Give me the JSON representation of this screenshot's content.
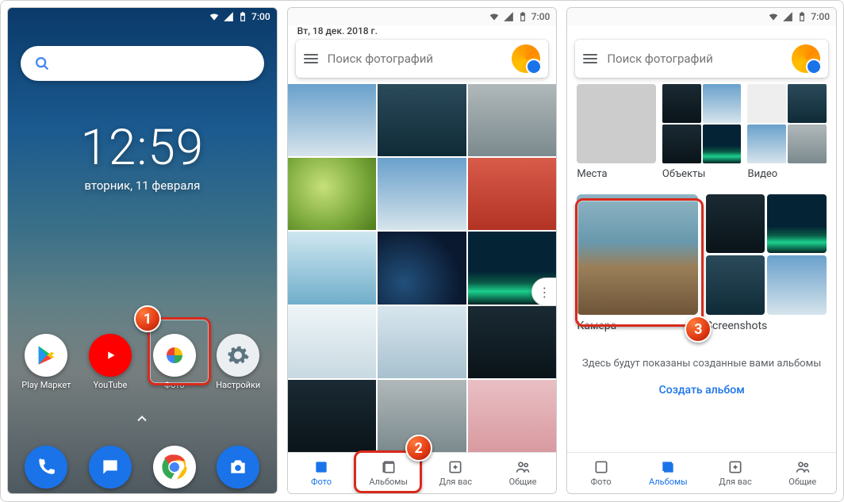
{
  "status_time": "7:00",
  "home": {
    "clock_time": "12:59",
    "clock_date": "вторник, 11 февраля",
    "apps": [
      {
        "label": "Play Маркет"
      },
      {
        "label": "YouTube"
      },
      {
        "label": "Фото"
      },
      {
        "label": "Настройки"
      }
    ]
  },
  "photos": {
    "date_header": "Вт, 18 дек. 2018 г.",
    "search_placeholder": "Поиск фотографий",
    "nav": {
      "photos": "Фото",
      "albums": "Альбомы",
      "foryou": "Для вас",
      "shared": "Общие"
    }
  },
  "albums": {
    "categories": [
      {
        "label": "Места"
      },
      {
        "label": "Объекты"
      },
      {
        "label": "Видео"
      }
    ],
    "items": [
      {
        "label": "Камера"
      },
      {
        "label": "Screenshots"
      }
    ],
    "empty_state": "Здесь будут показаны созданные вами альбомы",
    "create_cta": "Создать альбом"
  },
  "annotations": {
    "one": "1",
    "two": "2",
    "three": "3"
  }
}
